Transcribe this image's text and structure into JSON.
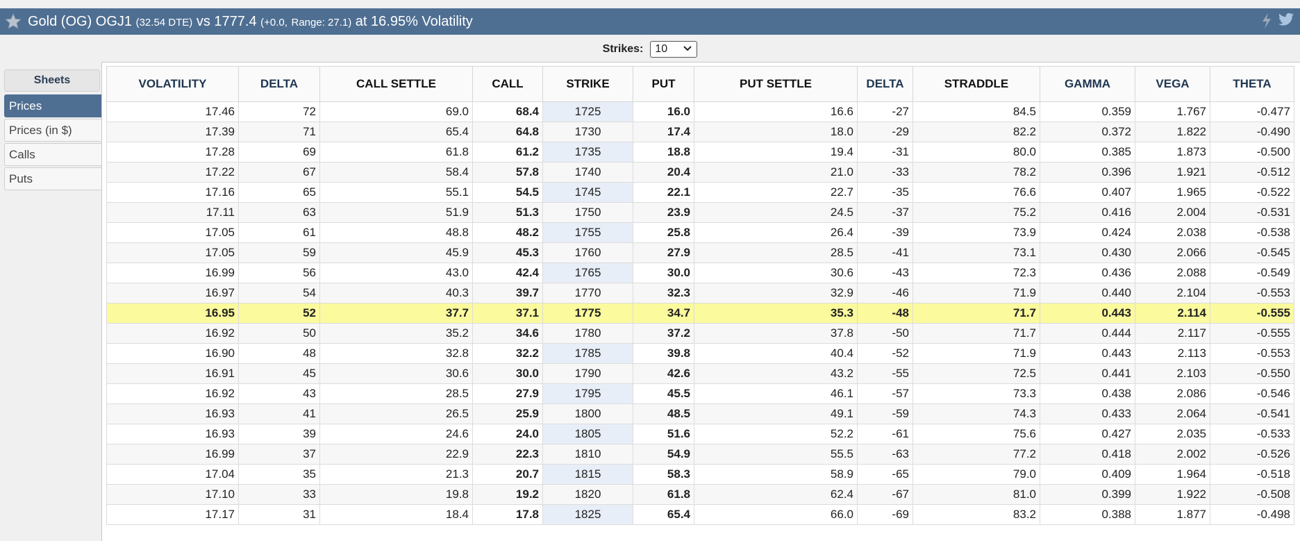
{
  "title": {
    "main": "Gold (OG) OGJ1",
    "dte": "(32.54 DTE)",
    "vs": "vs 1777.4",
    "change": "(+0.0,",
    "range": "Range: 27.1)",
    "vol": "at 16.95% Volatility"
  },
  "strikes": {
    "label": "Strikes:",
    "value": "10"
  },
  "sidebar": {
    "header": "Sheets",
    "items": [
      {
        "label": "Prices"
      },
      {
        "label": "Prices (in $)"
      },
      {
        "label": "Calls"
      },
      {
        "label": "Puts"
      }
    ]
  },
  "columns": [
    "VOLATILITY",
    "DELTA",
    "CALL SETTLE",
    "CALL",
    "STRIKE",
    "PUT",
    "PUT SETTLE",
    "DELTA",
    "STRADDLE",
    "GAMMA",
    "VEGA",
    "THETA"
  ],
  "rows": [
    [
      "17.46",
      "72",
      "69.0",
      "68.4",
      "1725",
      "16.0",
      "16.6",
      "-27",
      "84.5",
      "0.359",
      "1.767",
      "-0.477"
    ],
    [
      "17.39",
      "71",
      "65.4",
      "64.8",
      "1730",
      "17.4",
      "18.0",
      "-29",
      "82.2",
      "0.372",
      "1.822",
      "-0.490"
    ],
    [
      "17.28",
      "69",
      "61.8",
      "61.2",
      "1735",
      "18.8",
      "19.4",
      "-31",
      "80.0",
      "0.385",
      "1.873",
      "-0.500"
    ],
    [
      "17.22",
      "67",
      "58.4",
      "57.8",
      "1740",
      "20.4",
      "21.0",
      "-33",
      "78.2",
      "0.396",
      "1.921",
      "-0.512"
    ],
    [
      "17.16",
      "65",
      "55.1",
      "54.5",
      "1745",
      "22.1",
      "22.7",
      "-35",
      "76.6",
      "0.407",
      "1.965",
      "-0.522"
    ],
    [
      "17.11",
      "63",
      "51.9",
      "51.3",
      "1750",
      "23.9",
      "24.5",
      "-37",
      "75.2",
      "0.416",
      "2.004",
      "-0.531"
    ],
    [
      "17.05",
      "61",
      "48.8",
      "48.2",
      "1755",
      "25.8",
      "26.4",
      "-39",
      "73.9",
      "0.424",
      "2.038",
      "-0.538"
    ],
    [
      "17.05",
      "59",
      "45.9",
      "45.3",
      "1760",
      "27.9",
      "28.5",
      "-41",
      "73.1",
      "0.430",
      "2.066",
      "-0.545"
    ],
    [
      "16.99",
      "56",
      "43.0",
      "42.4",
      "1765",
      "30.0",
      "30.6",
      "-43",
      "72.3",
      "0.436",
      "2.088",
      "-0.549"
    ],
    [
      "16.97",
      "54",
      "40.3",
      "39.7",
      "1770",
      "32.3",
      "32.9",
      "-46",
      "71.9",
      "0.440",
      "2.104",
      "-0.553"
    ],
    [
      "16.95",
      "52",
      "37.7",
      "37.1",
      "1775",
      "34.7",
      "35.3",
      "-48",
      "71.7",
      "0.443",
      "2.114",
      "-0.555"
    ],
    [
      "16.92",
      "50",
      "35.2",
      "34.6",
      "1780",
      "37.2",
      "37.8",
      "-50",
      "71.7",
      "0.444",
      "2.117",
      "-0.555"
    ],
    [
      "16.90",
      "48",
      "32.8",
      "32.2",
      "1785",
      "39.8",
      "40.4",
      "-52",
      "71.9",
      "0.443",
      "2.113",
      "-0.553"
    ],
    [
      "16.91",
      "45",
      "30.6",
      "30.0",
      "1790",
      "42.6",
      "43.2",
      "-55",
      "72.5",
      "0.441",
      "2.103",
      "-0.550"
    ],
    [
      "16.92",
      "43",
      "28.5",
      "27.9",
      "1795",
      "45.5",
      "46.1",
      "-57",
      "73.3",
      "0.438",
      "2.086",
      "-0.546"
    ],
    [
      "16.93",
      "41",
      "26.5",
      "25.9",
      "1800",
      "48.5",
      "49.1",
      "-59",
      "74.3",
      "0.433",
      "2.064",
      "-0.541"
    ],
    [
      "16.93",
      "39",
      "24.6",
      "24.0",
      "1805",
      "51.6",
      "52.2",
      "-61",
      "75.6",
      "0.427",
      "2.035",
      "-0.533"
    ],
    [
      "16.99",
      "37",
      "22.9",
      "22.3",
      "1810",
      "54.9",
      "55.5",
      "-63",
      "77.2",
      "0.418",
      "2.002",
      "-0.526"
    ],
    [
      "17.04",
      "35",
      "21.3",
      "20.7",
      "1815",
      "58.3",
      "58.9",
      "-65",
      "79.0",
      "0.409",
      "1.964",
      "-0.518"
    ],
    [
      "17.10",
      "33",
      "19.8",
      "19.2",
      "1820",
      "61.8",
      "62.4",
      "-67",
      "81.0",
      "0.399",
      "1.922",
      "-0.508"
    ],
    [
      "17.17",
      "31",
      "18.4",
      "17.8",
      "1825",
      "65.4",
      "66.0",
      "-69",
      "83.2",
      "0.388",
      "1.877",
      "-0.498"
    ]
  ],
  "atm_row_index": 10
}
